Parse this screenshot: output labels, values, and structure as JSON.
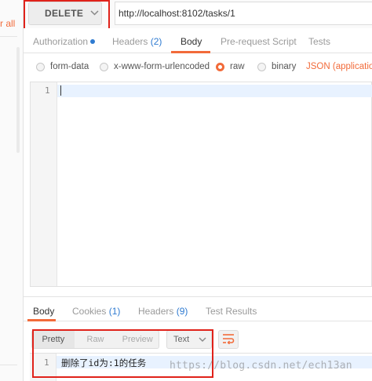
{
  "sidebar": {
    "clear_all_label": "r all"
  },
  "request": {
    "method": "DELETE",
    "url": "http://localhost:8102/tasks/1"
  },
  "request_tabs": [
    {
      "label": "Authorization",
      "count": "",
      "active": false
    },
    {
      "label": "Headers",
      "count": "(2)",
      "active": false
    },
    {
      "label": "Body",
      "count": "",
      "active": true
    },
    {
      "label": "Pre-request Script",
      "count": "",
      "active": false
    },
    {
      "label": "Tests",
      "count": "",
      "active": false
    }
  ],
  "body_types": [
    {
      "label": "form-data",
      "checked": false
    },
    {
      "label": "x-www-form-urlencoded",
      "checked": false
    },
    {
      "label": "raw",
      "checked": true
    },
    {
      "label": "binary",
      "checked": false
    }
  ],
  "content_type": "JSON (application",
  "request_editor": {
    "line_number": "1"
  },
  "response_tabs": [
    {
      "label": "Body",
      "count": "",
      "active": true
    },
    {
      "label": "Cookies",
      "count": "(1)",
      "active": false
    },
    {
      "label": "Headers",
      "count": "(9)",
      "active": false
    },
    {
      "label": "Test Results",
      "count": "",
      "active": false
    }
  ],
  "response_toolbar": {
    "views": [
      "Pretty",
      "Raw",
      "Preview"
    ],
    "format": "Text"
  },
  "response_editor": {
    "line_number": "1",
    "text": "删除了id为:1的任务"
  },
  "watermark": "https://blog.csdn.net/ech13an",
  "colors": {
    "accent": "#f26b3a",
    "link": "#2f7bd1",
    "highlight": "#e0221a"
  }
}
